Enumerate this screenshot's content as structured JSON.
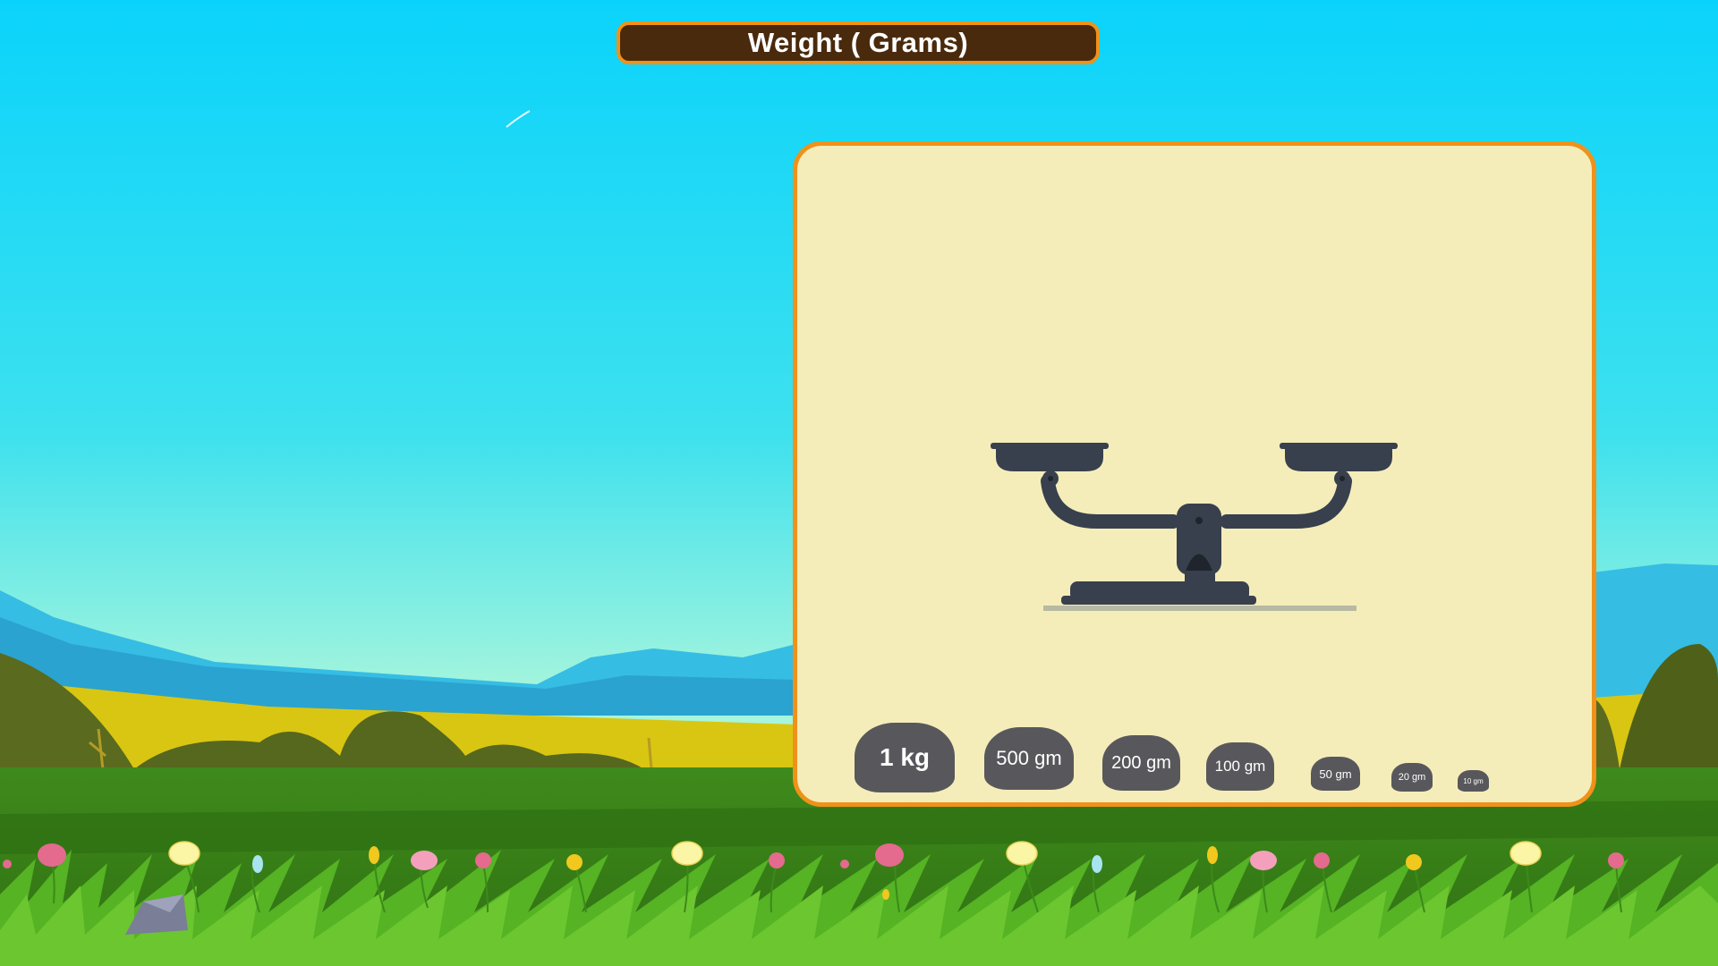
{
  "title": "Weight ( Grams)",
  "colors": {
    "sky_top": "#0ad3fb",
    "sky_bottom": "#a6f5dc",
    "grass": "#3f8a1c",
    "panel_bg": "#f5edb9",
    "panel_border": "#f0911a",
    "title_bg": "#4a2a0c",
    "scale": "#38404e",
    "weight": "#58585c"
  },
  "scale": {
    "icon": "balance-scale-icon"
  },
  "weights": [
    {
      "id": "1kg",
      "label": "1 kg"
    },
    {
      "id": "500gm",
      "label": "500 gm"
    },
    {
      "id": "200gm",
      "label": "200 gm"
    },
    {
      "id": "100gm",
      "label": "100 gm"
    },
    {
      "id": "50gm",
      "label": "50 gm"
    },
    {
      "id": "20gm",
      "label": "20 gm"
    },
    {
      "id": "10gm",
      "label": "10 gm"
    }
  ]
}
